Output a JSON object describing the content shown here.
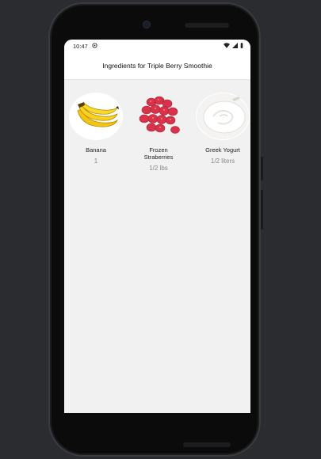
{
  "status_bar": {
    "time": "10:47"
  },
  "header": {
    "title": "Ingredients for Triple Berry Smoothie"
  },
  "ingredients": [
    {
      "name": "Banana",
      "quantity": "1",
      "image_icon": "banana-image"
    },
    {
      "name": "Frozen Straberries",
      "quantity": "1/2 lbs",
      "image_icon": "strawberries-image"
    },
    {
      "name": "Greek Yogurt",
      "quantity": "1/2 liters",
      "image_icon": "yogurt-image"
    }
  ],
  "colors": {
    "screen_background": "#f1f1f1",
    "header_background": "#ffffff",
    "quantity_text": "#888888"
  }
}
